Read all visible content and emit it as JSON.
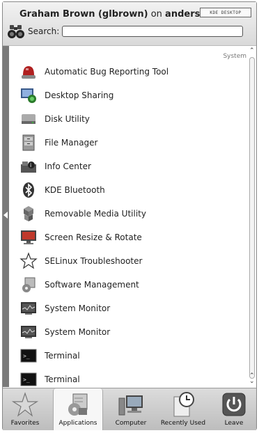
{
  "header": {
    "user_name": "Graham Brown (glbrown)",
    "on_text": "on",
    "host": "anderson.",
    "badge": "KDE DESKTOP"
  },
  "search": {
    "label": "Search:",
    "value": ""
  },
  "group_label": "System",
  "items": [
    {
      "label": "Automatic Bug Reporting Tool",
      "icon": "bug-report-icon"
    },
    {
      "label": "Desktop Sharing",
      "icon": "desktop-sharing-icon"
    },
    {
      "label": "Disk Utility",
      "icon": "disk-icon"
    },
    {
      "label": "File Manager",
      "icon": "file-cabinet-icon"
    },
    {
      "label": "Info Center",
      "icon": "info-center-icon"
    },
    {
      "label": "KDE Bluetooth",
      "icon": "bluetooth-icon"
    },
    {
      "label": "Removable Media Utility",
      "icon": "cubes-icon"
    },
    {
      "label": "Screen Resize & Rotate",
      "icon": "monitor-icon"
    },
    {
      "label": "SELinux Troubleshooter",
      "icon": "star-icon"
    },
    {
      "label": "Software Management",
      "icon": "software-icon"
    },
    {
      "label": "System Monitor",
      "icon": "system-monitor-icon"
    },
    {
      "label": "System Monitor",
      "icon": "system-monitor-icon"
    },
    {
      "label": "Terminal",
      "icon": "terminal-icon"
    },
    {
      "label": "Terminal",
      "icon": "terminal-icon"
    }
  ],
  "tabs": [
    {
      "label": "Favorites",
      "icon": "star-icon",
      "active": false
    },
    {
      "label": "Applications",
      "icon": "applications-icon",
      "active": true
    },
    {
      "label": "Computer",
      "icon": "computer-icon",
      "active": false
    },
    {
      "label": "Recently Used",
      "icon": "clock-icon",
      "active": false
    },
    {
      "label": "Leave",
      "icon": "power-icon",
      "active": false
    }
  ]
}
